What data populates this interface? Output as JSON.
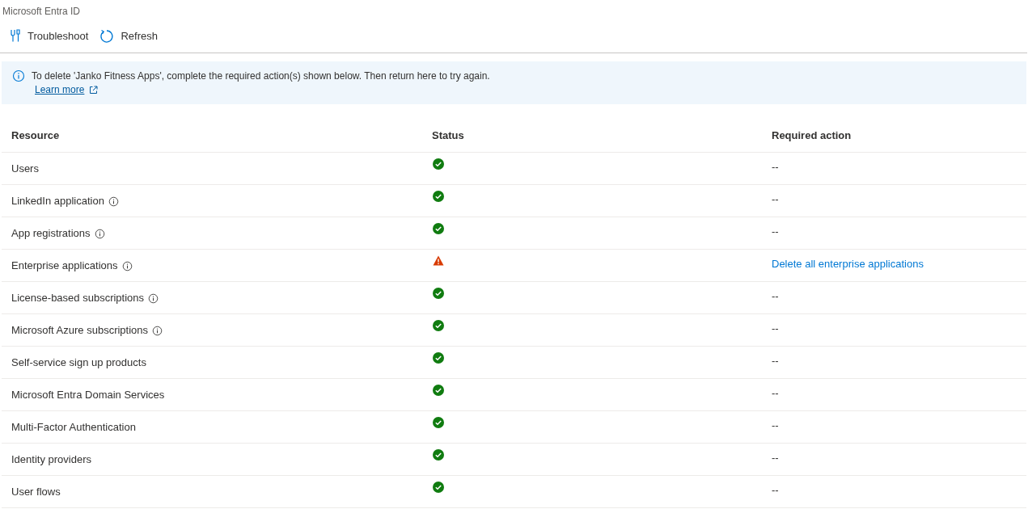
{
  "subtitle": "Microsoft Entra ID",
  "toolbar": [
    {
      "label": "Troubleshoot",
      "kind": "troubleshoot"
    },
    {
      "label": "Refresh",
      "kind": "refresh"
    }
  ],
  "banner": {
    "message": "To delete 'Janko Fitness Apps', complete the required action(s) shown below. Then return here to try again.",
    "link": "Learn more"
  },
  "table": {
    "columns": [
      "Resource",
      "Status",
      "Required action"
    ],
    "rows": [
      {
        "resource": "Users",
        "info": false,
        "kind": "ok",
        "action": "--"
      },
      {
        "resource": "LinkedIn application",
        "info": true,
        "kind": "ok",
        "action": "--"
      },
      {
        "resource": "App registrations",
        "info": true,
        "kind": "ok",
        "action": "--"
      },
      {
        "resource": "Enterprise applications",
        "info": true,
        "kind": "warning",
        "action": "Delete all enterprise applications"
      },
      {
        "resource": "License-based subscriptions",
        "info": true,
        "kind": "ok",
        "action": "--"
      },
      {
        "resource": "Microsoft Azure subscriptions",
        "info": true,
        "kind": "ok",
        "action": "--"
      },
      {
        "resource": "Self-service sign up products",
        "info": false,
        "kind": "ok",
        "action": "--"
      },
      {
        "resource": "Microsoft Entra Domain Services",
        "info": false,
        "kind": "ok",
        "action": "--"
      },
      {
        "resource": "Multi-Factor Authentication",
        "info": false,
        "kind": "ok",
        "action": "--"
      },
      {
        "resource": "Identity providers",
        "info": false,
        "kind": "ok",
        "action": "--"
      },
      {
        "resource": "User flows",
        "info": false,
        "kind": "ok",
        "action": "--"
      }
    ]
  }
}
